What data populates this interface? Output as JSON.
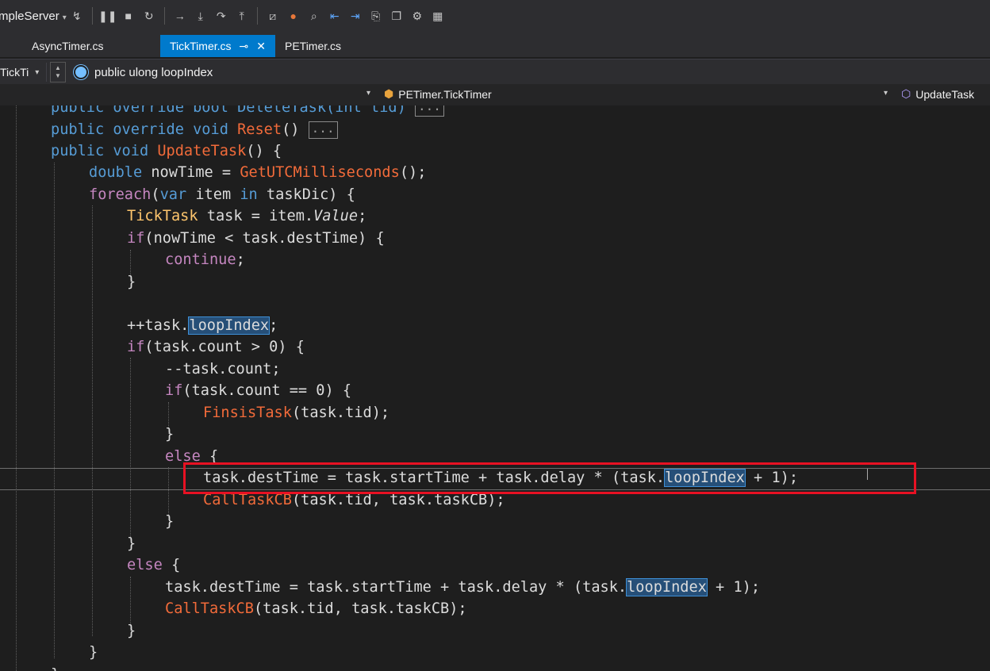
{
  "toolbar": {
    "project": "mpleServer"
  },
  "tabs": [
    {
      "label": "AsyncTimer.cs"
    },
    {
      "label": "TickTimer.cs"
    },
    {
      "label": "PETimer.cs"
    }
  ],
  "nav": {
    "left_combo": "TickTi",
    "member": "public ulong loopIndex",
    "class": "PETimer.TickTimer",
    "method": "UpdateTask"
  },
  "code": {
    "l0_text": "public override bool DeleteTask(int tid)",
    "collapsed": "...",
    "l1_kw": "public override void",
    "l1_fn": "Reset",
    "l1_tail": "() ",
    "l2_kw": "public void",
    "l2_fn": "UpdateTask",
    "l2_tail": "() {",
    "l3_kw": "double",
    "l3_a": " nowTime = ",
    "l3_fn": "GetUTCMilliseconds",
    "l3_tail": "();",
    "l4_ctl": "foreach",
    "l4_a": "(",
    "l4_kw": "var",
    "l4_b": " item ",
    "l4_kw2": "in",
    "l4_c": " taskDic) {",
    "l5_ty": "TickTask",
    "l5_a": " task = item.",
    "l5_val": "Value",
    "l5_tail": ";",
    "l6_ctl": "if",
    "l6_a": "(nowTime < task.destTime) {",
    "l7_ctl": "continue",
    "l7_tail": ";",
    "close": "}",
    "l9_a": "++task.",
    "loopIndex": "loopIndex",
    "semi": ";",
    "l10_ctl": "if",
    "l10_a": "(task.count > 0) {",
    "l11_a": "--task.count;",
    "l12_ctl": "if",
    "l12_a": "(task.count == 0) {",
    "l13_fn": "FinsisTask",
    "l13_a": "(task.tid);",
    "else": "else",
    "else_tail": " {",
    "l16_a": "task.destTime = task.startTime + task.delay * (task.",
    "l16_tail": " + 1);",
    "l17_fn": "CallTaskCB",
    "l17_a": "(task.tid, task.taskCB);"
  }
}
